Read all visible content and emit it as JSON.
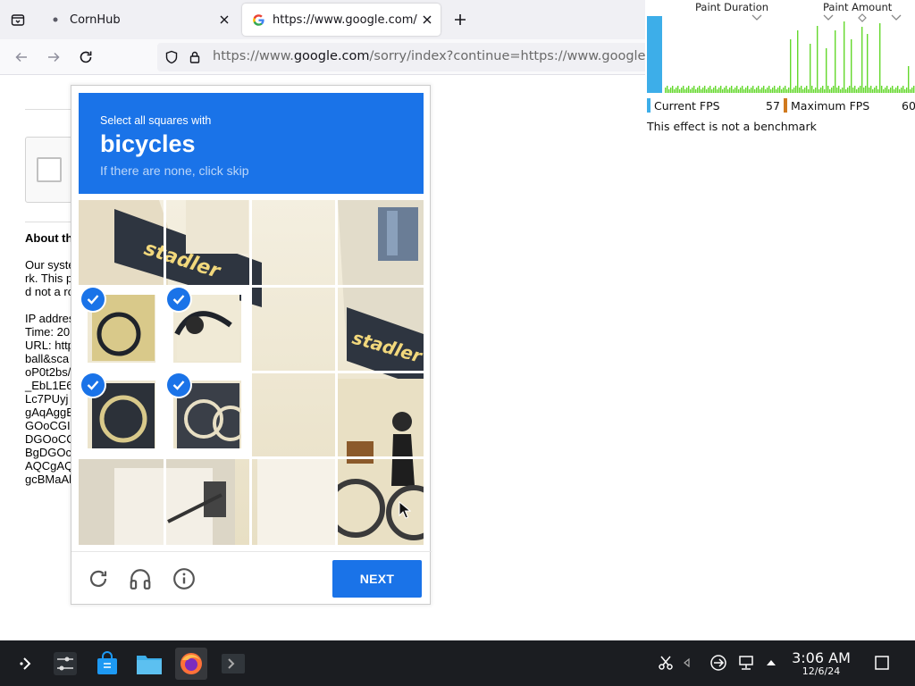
{
  "browser": {
    "tabs": [
      {
        "title": "CornHub",
        "active": false
      },
      {
        "title": "https://www.google.com/s",
        "active": true
      }
    ],
    "url": {
      "prefix": "https://www.",
      "domain": "google.com",
      "rest": "/sorry/index?continue=https://www.google.com/s"
    }
  },
  "page": {
    "about_title": "About th",
    "about_lines": [
      "Our syste",
      "rk. This p",
      "d not a ro",
      "",
      "IP addres",
      "Time: 20",
      "URL: http",
      "ball&sca",
      "oP0t2bs/",
      "_EbL1E6",
      "Lc7PUyj",
      "gAqAggB",
      "GOoCGI",
      "DGOoCC",
      "BgDGOc",
      "AQCgAQ",
      "gcBMaAl"
    ]
  },
  "captcha": {
    "instruction": "Select all squares with",
    "keyword": "bicycles",
    "hint": "If there are none, click skip",
    "next_label": "NEXT",
    "selected_tiles": [
      [
        1,
        0
      ],
      [
        1,
        1
      ],
      [
        2,
        0
      ],
      [
        2,
        1
      ]
    ]
  },
  "fps_overlay": {
    "paint_duration_label": "Paint Duration",
    "paint_amount_label": "Paint Amount",
    "current_fps_label": "Current FPS",
    "current_fps_value": "57",
    "max_fps_label": "Maximum FPS",
    "max_fps_value": "60",
    "note": "This effect is not a benchmark",
    "colors": {
      "current": "#3daee9",
      "max": "#d07a1f",
      "graph": "#64d82c"
    }
  },
  "taskbar": {
    "time": "3:06 AM",
    "date": "12/6/24",
    "apps": [
      "application-launcher-icon",
      "system-settings-icon",
      "discover-store-icon",
      "file-manager-icon",
      "firefox-icon",
      "konsole-icon"
    ]
  }
}
